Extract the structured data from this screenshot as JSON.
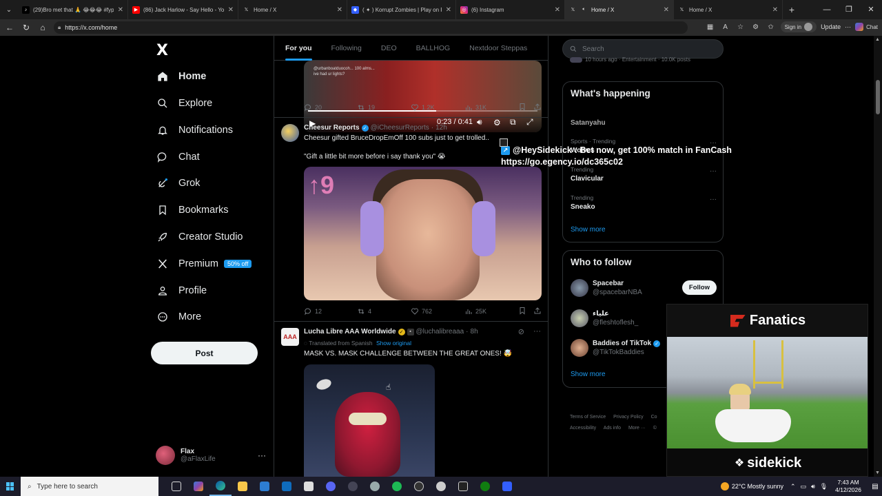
{
  "browser": {
    "tabs": [
      {
        "title": "(29)Bro met that 🙏 😂😂😂 #fyp",
        "color": "#000000",
        "icon": "tiktok-icon",
        "active": false
      },
      {
        "title": "(86) Jack Harlow - Say Hello - You",
        "color": "#ff0000",
        "icon": "youtube-icon",
        "active": false
      },
      {
        "title": "Home / X",
        "color": "#000000",
        "icon": "x-icon",
        "active": false
      },
      {
        "title": "( ✦ ) Korrupt Zombies | Play on Ro",
        "color": "#335fff",
        "icon": "roblox-icon",
        "active": false
      },
      {
        "title": "(6) Instagram",
        "color": "#e1306c",
        "icon": "instagram-icon",
        "active": false
      },
      {
        "title": "Home / X",
        "color": "#000000",
        "icon": "x-icon",
        "active": true
      },
      {
        "title": "Home / X",
        "color": "#000000",
        "icon": "x-icon",
        "active": false
      }
    ],
    "url": "https://x.com/home",
    "sign_in": "Sign in",
    "update": "Update",
    "chat": "Chat"
  },
  "nav": {
    "logo": "X",
    "items": [
      {
        "label": "Home",
        "icon": "home-icon"
      },
      {
        "label": "Explore",
        "icon": "search-icon"
      },
      {
        "label": "Notifications",
        "icon": "bell-icon"
      },
      {
        "label": "Chat",
        "icon": "chat-bubble-icon"
      },
      {
        "label": "Grok",
        "icon": "grok-icon"
      },
      {
        "label": "Bookmarks",
        "icon": "bookmark-icon"
      },
      {
        "label": "Creator Studio",
        "icon": "rocket-icon"
      },
      {
        "label": "Premium",
        "icon": "x-premium-icon",
        "badge": "50% off"
      },
      {
        "label": "Profile",
        "icon": "person-icon"
      },
      {
        "label": "More",
        "icon": "more-circle-icon"
      }
    ],
    "post": "Post",
    "account": {
      "name": "Flax",
      "handle": "@aFlaxLife"
    }
  },
  "timeline": {
    "tabs": [
      "For you",
      "Following",
      "DEO",
      "BALLHOG",
      "Nextdoor Steppas"
    ],
    "video": {
      "time": "0:23 / 0:41",
      "progress": 0.56,
      "caption_line1": "@urbanboatduocoh... 100 alms...",
      "caption_line2": "ive had ur lights?"
    },
    "tweet0_actions": {
      "replies": "20",
      "reposts": "19",
      "likes": "1.2K",
      "views": "31K"
    },
    "tweet1": {
      "name": "Cheesur Reports",
      "handle": "@iCheesurReports",
      "time": "12h",
      "line1": "Cheesur gifted BruceDropEmOff 100 subs just to get trolled..",
      "line2": "\"Gift a little bit more before i say thank you\" 😭",
      "actions": {
        "replies": "12",
        "reposts": "4",
        "likes": "762",
        "views": "25K"
      }
    },
    "tweet2": {
      "name": "Lucha Libre AAA Worldwide",
      "handle": "@luchalibreaaa",
      "time": "8h",
      "translated": "Translated from Spanish",
      "show_original": "Show original",
      "text": "MASK VS. MASK CHALLENGE BETWEEN THE GREAT ONES! 🤯"
    },
    "separator": "·"
  },
  "right": {
    "search_placeholder": "Search",
    "top_meta": "10 hours ago · Entertainment · 10.0K posts",
    "happening_title": "What's happening",
    "trends": [
      {
        "category": "Sports · Trending",
        "title": "Wolves"
      },
      {
        "category": "Trending",
        "title": "Clavicular"
      },
      {
        "category": "Trending",
        "title": "Sneako"
      }
    ],
    "hidden_trend": "Satanyahu",
    "show_more": "Show more",
    "follow_title": "Who to follow",
    "follow": [
      {
        "name": "Spacebar",
        "handle": "@spacebarNBA",
        "verified": false
      },
      {
        "name": "علياء",
        "handle": "@fleshtoflesh_",
        "verified": false
      },
      {
        "name": "Baddies of TikTok",
        "handle": "@TikTokBaddies",
        "verified": true
      }
    ],
    "follow_button": "Follow",
    "footer": [
      "Terms of Service",
      "Privacy Policy",
      "Co",
      "Accessibility",
      "Ads info",
      "More ···",
      "©"
    ]
  },
  "sidekick": {
    "line1_handle": "@HeySidekick",
    "line1_text": ": Bet now, get 100% match in FanCash",
    "line2": "https://go.egency.io/dc365c02",
    "ad_brand": "Fanatics",
    "ad_footer": "sidekick"
  },
  "taskbar": {
    "search_placeholder": "Type here to search",
    "weather": "22°C  Mostly sunny",
    "time": "7:43 AM",
    "date": "4/12/2026"
  }
}
